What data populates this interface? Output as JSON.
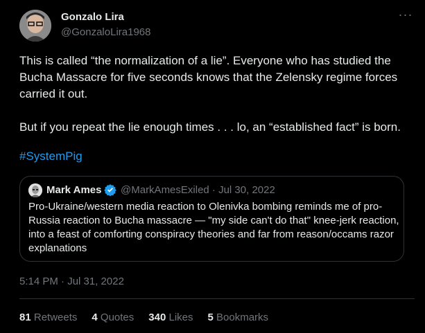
{
  "tweet": {
    "author_name": "Gonzalo Lira",
    "author_handle": "@GonzaloLira1968",
    "more_label": "···",
    "paragraph1": "This is called “the normalization of a lie”. Everyone who has studied the Bucha Massacre for five seconds knows that the Zelensky regime forces carried it out.",
    "paragraph2": "But if you repeat the lie enough times . . . lo, an “established fact” is born.",
    "hashtag": "#SystemPig",
    "timestamp": "5:14 PM · Jul 31, 2022"
  },
  "quote": {
    "author_name": "Mark Ames",
    "author_handle_date": "@MarkAmesExiled · Jul 30, 2022",
    "text": "Pro-Ukraine/western media reaction to Olenivka bombing reminds me of pro-Russia reaction to Bucha massacre — \"my side can't do that\" knee-jerk reaction, into a feast of comforting conspiracy theories and far from reason/occams razor explanations"
  },
  "stats": {
    "retweets_count": "81",
    "retweets_label": "Retweets",
    "quotes_count": "4",
    "quotes_label": "Quotes",
    "likes_count": "340",
    "likes_label": "Likes",
    "bookmarks_count": "5",
    "bookmarks_label": "Bookmarks"
  },
  "colors": {
    "background": "#000000",
    "text": "#e7e9ea",
    "muted": "#71767b",
    "link": "#1d9bf0",
    "border": "#2f3336"
  }
}
